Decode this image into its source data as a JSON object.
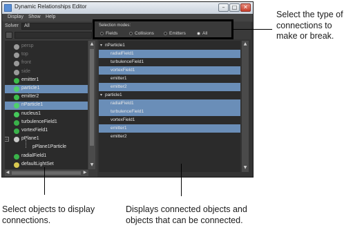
{
  "window": {
    "title": "Dynamic Relationships Editor",
    "controls": {
      "minimize": "–",
      "maximize": "□",
      "close": "✕"
    }
  },
  "menu": [
    "Display",
    "Show",
    "Help"
  ],
  "left_pane": {
    "solver_label": "Solver",
    "solver_value": "All",
    "outliner": [
      {
        "label": "persp",
        "icon": "camera-icon",
        "selected": false,
        "dim": true
      },
      {
        "label": "top",
        "icon": "camera-icon",
        "selected": false,
        "dim": true
      },
      {
        "label": "front",
        "icon": "camera-icon",
        "selected": false,
        "dim": true
      },
      {
        "label": "side",
        "icon": "camera-icon",
        "selected": false,
        "dim": true
      },
      {
        "label": "emitter1",
        "icon": "emitter-icon",
        "selected": false,
        "dim": false
      },
      {
        "label": "particle1",
        "icon": "particle-icon",
        "selected": true,
        "dim": false
      },
      {
        "label": "emitter2",
        "icon": "emitter-icon",
        "selected": false,
        "dim": false
      },
      {
        "label": "nParticle1",
        "icon": "nparticle-icon",
        "selected": true,
        "dim": false
      },
      {
        "label": "nucleus1",
        "icon": "nucleus-icon",
        "selected": false,
        "dim": false
      },
      {
        "label": "turbulenceField1",
        "icon": "field-icon",
        "selected": false,
        "dim": false
      },
      {
        "label": "vortexField1",
        "icon": "field-icon",
        "selected": false,
        "dim": false
      },
      {
        "label": "pPlane1",
        "icon": "mesh-icon",
        "selected": false,
        "dim": false
      },
      {
        "label": "pPlane1Particle",
        "icon": "none",
        "selected": false,
        "dim": false
      },
      {
        "label": "radialField1",
        "icon": "field-icon",
        "selected": false,
        "dim": false
      },
      {
        "label": "defaultLightSet",
        "icon": "lightset-icon",
        "selected": false,
        "dim": false
      }
    ]
  },
  "right_pane": {
    "modes_title": "Selection modes:",
    "modes": [
      {
        "label": "Fields",
        "on": false
      },
      {
        "label": "Collisions",
        "on": false
      },
      {
        "label": "Emitters",
        "on": false
      },
      {
        "label": "All",
        "on": true
      }
    ],
    "groups": [
      {
        "name": "nParticle1",
        "items": [
          {
            "label": "radialField1",
            "connected": true
          },
          {
            "label": "turbulenceField1",
            "connected": false
          },
          {
            "label": "vortexField1",
            "connected": true
          },
          {
            "label": "emitter1",
            "connected": false
          },
          {
            "label": "emitter2",
            "connected": true
          }
        ]
      },
      {
        "name": "particle1",
        "items": [
          {
            "label": "radialField1",
            "connected": true
          },
          {
            "label": "turbulenceField1",
            "connected": true
          },
          {
            "label": "vortexField1",
            "connected": false
          },
          {
            "label": "emitter1",
            "connected": true
          },
          {
            "label": "emitter2",
            "connected": false
          }
        ]
      }
    ]
  },
  "callouts": {
    "top_right": "Select the type of connections to make or break.",
    "bottom_left": "Select objects to display connections.",
    "bottom_right": "Displays connected objects and objects that can be connected."
  },
  "colors": {
    "selection": "#6a8eb8",
    "panel": "#2b2b2b",
    "window": "#3c3c3c"
  }
}
